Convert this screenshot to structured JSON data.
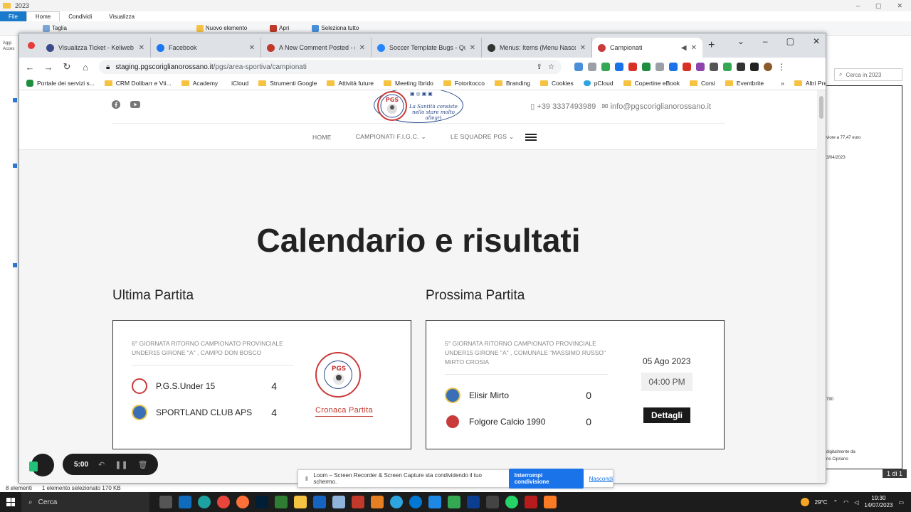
{
  "explorer": {
    "path_label": "2023",
    "ribbon_tabs": [
      "File",
      "Home",
      "Condividi",
      "Visualizza"
    ],
    "ribbon_items": [
      "Taglia",
      "Nuovo elemento",
      "Apri",
      "Seleziona tutto"
    ],
    "left_labels": [
      "Aggi",
      "Acces"
    ],
    "search_placeholder": "Cerca in 2023",
    "preview_lines": [
      "viore a 77,47 euro",
      "3/04/2023",
      "790",
      "digitalmente da",
      "no Cipriano"
    ],
    "status_items": "8 elementi",
    "status_selected": "1 elemento selezionato  170 KB",
    "page_indicator": "1 di 1"
  },
  "browser": {
    "tabs": [
      {
        "title": "Visualizza Ticket - Keliweb",
        "icon": "keliweb-icon",
        "color": "#3b4a8a"
      },
      {
        "title": "Facebook",
        "icon": "facebook-icon",
        "color": "#1877f2"
      },
      {
        "title": "A New Comment Posted - gioa",
        "icon": "gmail-icon",
        "color": "#c0392b"
      },
      {
        "title": "Soccer Template Bugs - Questic",
        "icon": "jira-icon",
        "color": "#2684ff"
      },
      {
        "title": "Menus: Items (Menu Nascosti)",
        "icon": "joomla-icon",
        "color": "#333333"
      },
      {
        "title": "Campionati",
        "icon": "pgs-icon",
        "color": "#c93a3a"
      }
    ],
    "url_host": "staging.pgscoriglianorossano.it",
    "url_path": "/pgs/area-sportiva/campionati",
    "bookmarks": [
      "Portale dei servizi s...",
      "CRM Dolibarr e Vti...",
      "Academy",
      "iCloud",
      "Strumenti Google",
      "Attività future",
      "Meeting Ibrido",
      "Fotoritocco",
      "Branding",
      "Cookies",
      "pCloud",
      "Copertine eBook",
      "Corsi",
      "Eventbrite"
    ],
    "bookmarks_more": "Altri Preferiti"
  },
  "site": {
    "phone": "+39 3337493989",
    "email": "info@pgscoriglianorossano.it",
    "logo_text": "La Santità consiste nello stare molto allegri",
    "nav": [
      "HOME",
      "CAMPIONATI F.I.G.C.",
      "LE SQUADRE PGS"
    ],
    "page_title": "Calendario e risultati",
    "last_match": {
      "heading": "Ultima Partita",
      "meta": "6° GIORNATA RITORNO CAMPIONATO PROVINCIALE UNDER15 GIRONE \"A\" , CAMPO DON BOSCO",
      "home_team": "P.G.S.Under 15",
      "home_score": "4",
      "away_team": "SPORTLAND CLUB APS",
      "away_score": "4",
      "link": "Cronaca Partita"
    },
    "next_match": {
      "heading": "Prossima Partita",
      "meta": "5° GIORNATA RITORNO CAMPIONATO PROVINCIALE UNDER15 GIRONE \"A\" , COMUNALE \"MASSIMO RUSSO\" MIRTO CROSIA",
      "home_team": "Elisir Mirto",
      "home_score": "0",
      "away_team": "Folgore Calcio 1990",
      "away_score": "0",
      "date": "05 Ago 2023",
      "time": "04:00 PM",
      "button": "Dettagli"
    }
  },
  "loom": {
    "timer": "5:00",
    "share_message": "Loom – Screen Recorder & Screen Capture sta condividendo il tuo schermo.",
    "stop_label": "Interrompi condivisione",
    "hide_label": "Nascondi"
  },
  "taskbar": {
    "search_label": "Cerca",
    "temperature": "29°C",
    "time": "19:30",
    "date": "14/07/2023"
  }
}
